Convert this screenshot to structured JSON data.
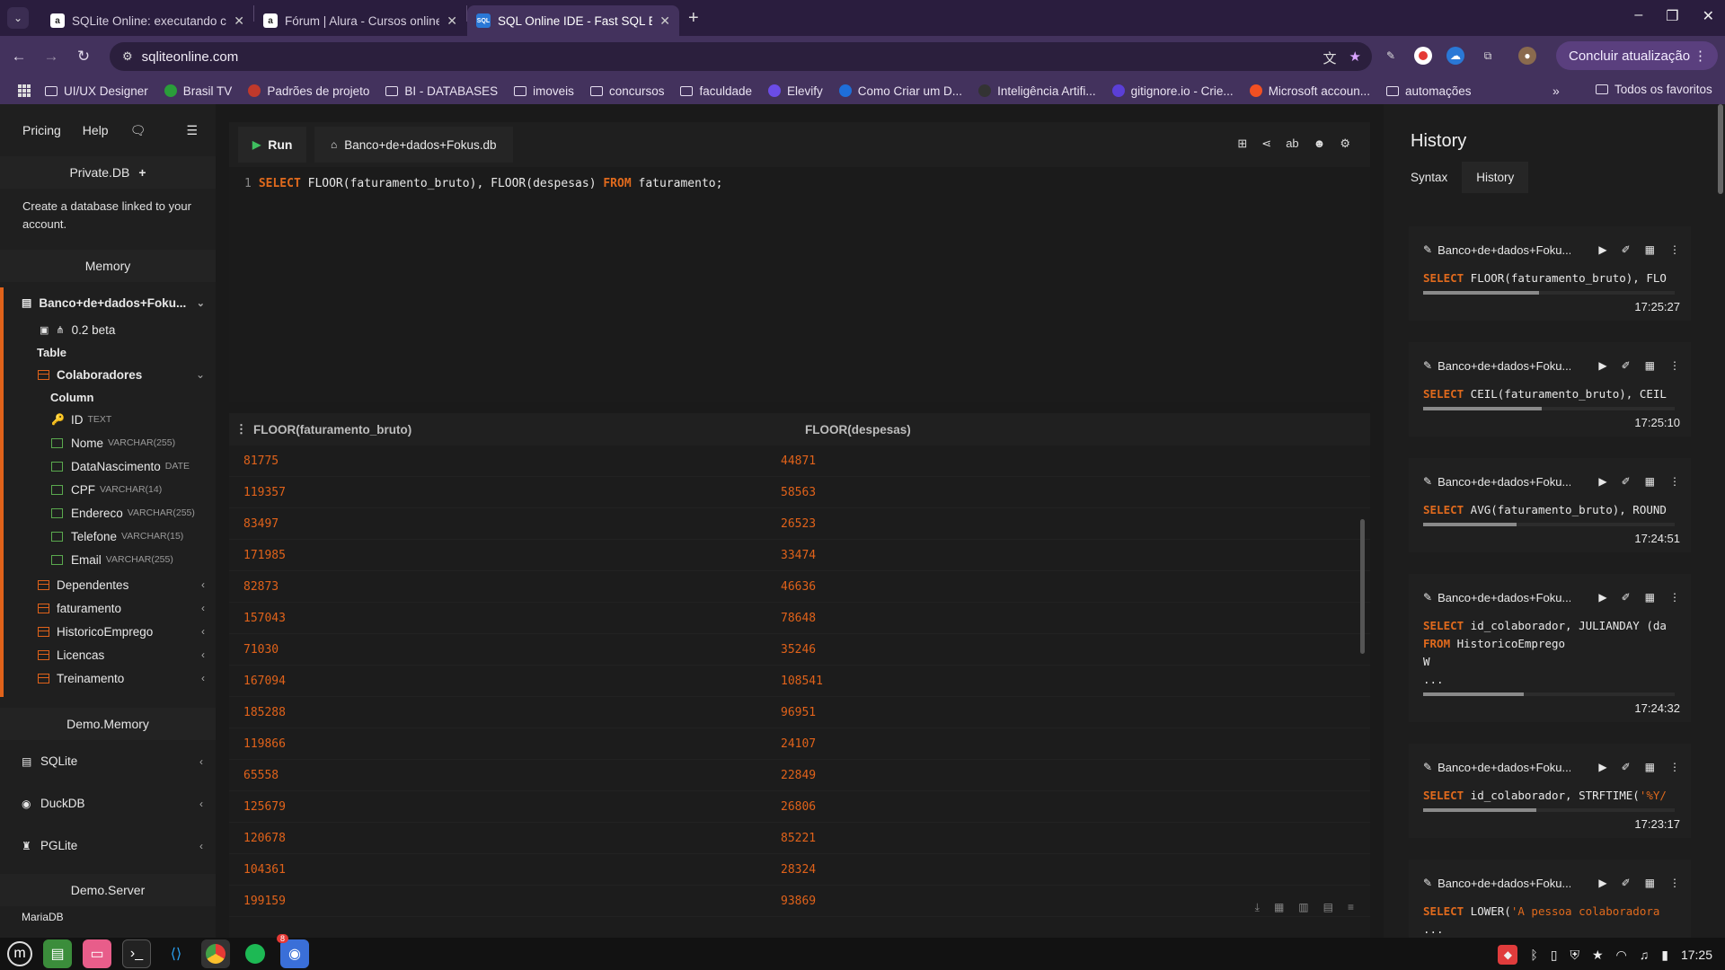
{
  "browser": {
    "tabs": [
      {
        "title": "SQLite Online: executando c",
        "favicon": "a",
        "active": false
      },
      {
        "title": "Fórum | Alura - Cursos online",
        "favicon": "a",
        "active": false
      },
      {
        "title": "SQL Online IDE - Fast SQL Ed",
        "favicon": "SQL",
        "active": true
      }
    ],
    "url": "sqliteonline.com",
    "update_button": "Concluir atualização",
    "bookmarks": [
      {
        "label": "UI/UX Designer",
        "type": "folder"
      },
      {
        "label": "Brasil TV",
        "type": "site",
        "color": "#2a9d3a"
      },
      {
        "label": "Padrões de projeto",
        "type": "site",
        "color": "#c0392b"
      },
      {
        "label": "BI - DATABASES",
        "type": "folder"
      },
      {
        "label": "imoveis",
        "type": "folder"
      },
      {
        "label": "concursos",
        "type": "folder"
      },
      {
        "label": "faculdade",
        "type": "folder"
      },
      {
        "label": "Elevify",
        "type": "site",
        "color": "#6b4ce6"
      },
      {
        "label": "Como Criar um D...",
        "type": "site",
        "color": "#1e6fd9"
      },
      {
        "label": "Inteligência Artifi...",
        "type": "site",
        "color": "#333333"
      },
      {
        "label": "gitignore.io - Crie...",
        "type": "site",
        "color": "#5b3fd6"
      },
      {
        "label": "Microsoft accoun...",
        "type": "site",
        "color": "#f25022"
      },
      {
        "label": "automações",
        "type": "folder"
      }
    ],
    "bookmarks_more": "»",
    "all_bookmarks": "Todos os favoritos"
  },
  "sidebar": {
    "nav": [
      "Pricing",
      "Help"
    ],
    "private_db": "Private.DB",
    "private_desc": "Create a database linked to your account.",
    "memory_label": "Memory",
    "db_name": "Banco+de+dados+Foku...",
    "version": "0.2 beta",
    "table_label": "Table",
    "expanded_table": "Colaboradores",
    "column_label": "Column",
    "columns": [
      {
        "name": "ID",
        "type": "TEXT",
        "key": true
      },
      {
        "name": "Nome",
        "type": "VARCHAR(255)"
      },
      {
        "name": "DataNascimento",
        "type": "DATE"
      },
      {
        "name": "CPF",
        "type": "VARCHAR(14)"
      },
      {
        "name": "Endereco",
        "type": "VARCHAR(255)"
      },
      {
        "name": "Telefone",
        "type": "VARCHAR(15)"
      },
      {
        "name": "Email",
        "type": "VARCHAR(255)"
      }
    ],
    "tables": [
      "Dependentes",
      "faturamento",
      "HistoricoEmprego",
      "Licencas",
      "Treinamento"
    ],
    "demo_memory_label": "Demo.Memory",
    "demo_dbs": [
      "SQLite",
      "DuckDB",
      "PGLite"
    ],
    "demo_server_label": "Demo.Server",
    "demo_server_partial": "MariaDB"
  },
  "editor": {
    "run_label": "Run",
    "db_tab": "Banco+de+dados+Fokus.db",
    "line_number": "1",
    "query": {
      "select": "SELECT",
      "cols": "FLOOR(faturamento_bruto), FLOOR(despesas)",
      "from": "FROM",
      "table": "faturamento;"
    }
  },
  "results": {
    "headers": [
      "FLOOR(faturamento_bruto)",
      "FLOOR(despesas)"
    ],
    "rows": [
      [
        "81775",
        "44871"
      ],
      [
        "119357",
        "58563"
      ],
      [
        "83497",
        "26523"
      ],
      [
        "171985",
        "33474"
      ],
      [
        "82873",
        "46636"
      ],
      [
        "157043",
        "78648"
      ],
      [
        "71030",
        "35246"
      ],
      [
        "167094",
        "108541"
      ],
      [
        "185288",
        "96951"
      ],
      [
        "119866",
        "24107"
      ],
      [
        "65558",
        "22849"
      ],
      [
        "125679",
        "26806"
      ],
      [
        "120678",
        "85221"
      ],
      [
        "104361",
        "28324"
      ],
      [
        "199159",
        "93869"
      ]
    ]
  },
  "history": {
    "title": "History",
    "tabs": [
      "Syntax",
      "History"
    ],
    "items": [
      {
        "db": "Banco+de+dados+Foku...",
        "lines": [
          {
            "kw": "SELECT",
            "rest": " FLOOR(faturamento_bruto), FLO"
          }
        ],
        "progress": 0.46,
        "time": "17:25:27"
      },
      {
        "db": "Banco+de+dados+Foku...",
        "lines": [
          {
            "kw": "SELECT",
            "rest": " CEIL(faturamento_bruto), CEIL"
          }
        ],
        "progress": 0.47,
        "time": "17:25:10"
      },
      {
        "db": "Banco+de+dados+Foku...",
        "lines": [
          {
            "kw": "SELECT",
            "rest": " AVG(faturamento_bruto), ROUND"
          }
        ],
        "progress": 0.37,
        "time": "17:24:51"
      },
      {
        "db": "Banco+de+dados+Foku...",
        "lines": [
          {
            "kw": "SELECT",
            "rest": " id_colaborador, JULIANDAY (da"
          },
          {
            "kw": "FROM",
            "rest": " HistoricoEmprego"
          },
          {
            "kw": "",
            "rest": "W"
          },
          {
            "kw": "",
            "rest": "..."
          }
        ],
        "progress": 0.4,
        "time": "17:24:32"
      },
      {
        "db": "Banco+de+dados+Foku...",
        "lines": [
          {
            "kw": "SELECT",
            "rest": " id_colaborador, STRFTIME(",
            "str": "'%Y/"
          }
        ],
        "progress": 0.45,
        "time": "17:23:17"
      },
      {
        "db": "Banco+de+dados+Foku...",
        "lines": [
          {
            "kw": "SELECT",
            "rest": " LOWER(",
            "str": "'A pessoa colaboradora"
          },
          {
            "kw": "",
            "rest": "..."
          }
        ],
        "progress": 0.3,
        "time": ""
      }
    ]
  },
  "taskbar": {
    "clock": "17:25",
    "badge": "8"
  }
}
